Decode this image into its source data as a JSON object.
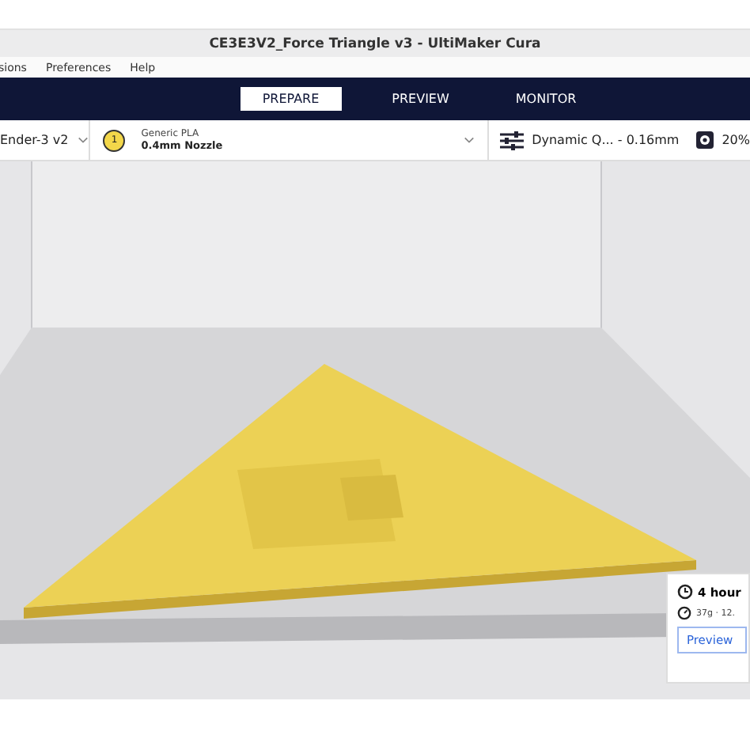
{
  "window": {
    "title": "CE3E3V2_Force Triangle v3 - UltiMaker Cura"
  },
  "menu": [
    "sions",
    "Preferences",
    "Help"
  ],
  "tabs": [
    {
      "label": "PREPARE",
      "selected": true
    },
    {
      "label": "PREVIEW",
      "selected": false
    },
    {
      "label": "MONITOR",
      "selected": false
    }
  ],
  "toolbar": {
    "printer": "Ender-3 v2",
    "material_badge": "1",
    "material": "Generic PLA",
    "nozzle": "0.4mm Nozzle",
    "profile": "Dynamic Q... - 0.16mm",
    "infill": "20%"
  },
  "estimate": {
    "time": "4 hour",
    "material": "37g · 12.",
    "button": "Preview"
  }
}
